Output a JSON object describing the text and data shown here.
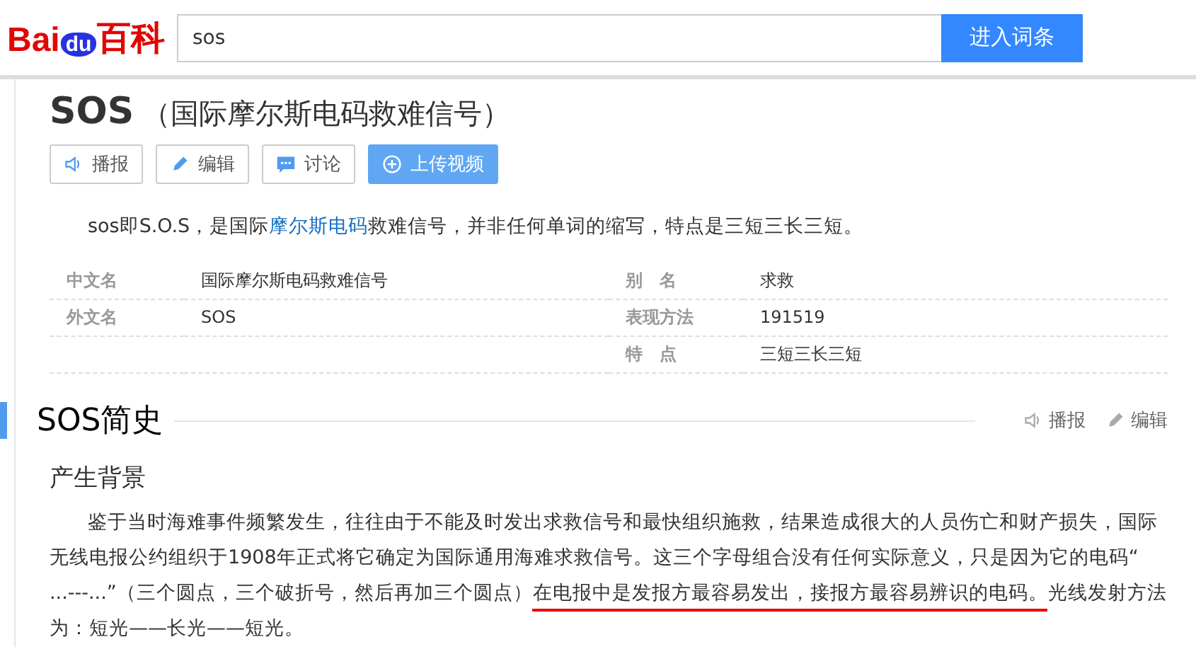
{
  "header": {
    "logo_latin": "Bai",
    "logo_paw": "du",
    "logo_cn": "百科",
    "search": {
      "value": "sos"
    },
    "search_button": "进入词条"
  },
  "entry": {
    "title": "SOS",
    "subtitle": "（国际摩尔斯电码救难信号）",
    "actions": [
      {
        "label": "播报",
        "kind": "speaker",
        "primary": false
      },
      {
        "label": "编辑",
        "kind": "pencil",
        "primary": false
      },
      {
        "label": "讨论",
        "kind": "chat",
        "primary": false
      },
      {
        "label": "上传视频",
        "kind": "plus",
        "primary": true
      }
    ],
    "summary": [
      {
        "text": "sos即S.O.S，是国际",
        "kind": "plain"
      },
      {
        "text": "摩尔斯电码",
        "kind": "link"
      },
      {
        "text": "救难信号，并非任何单词的缩写，特点是三短三长三短。",
        "kind": "plain"
      }
    ],
    "basic_info": [
      {
        "name": "中文名",
        "value": "国际摩尔斯电码救难信号",
        "name_2": "别　名",
        "value_2": "求救"
      },
      {
        "name": "外文名",
        "value": "SOS",
        "name_2": "表现方法",
        "value_2": "191519"
      },
      {
        "name_2": "特　点",
        "value_2": "三短三长三短"
      }
    ]
  },
  "section": {
    "title": "SOS简史",
    "actions": [
      {
        "label": "播报",
        "kind": "speaker"
      },
      {
        "label": "编辑",
        "kind": "pencil"
      }
    ],
    "subheading": "产生背景",
    "paragraph": [
      {
        "text": "鉴于当时海难事件频繁发生，往往由于不能及时发出求救信号和最快组织施救，结果造成很大的人员伤亡和财产损失，国际无线电报公约组织于1908年正式将它确定为国际通用海难求救信号。这三个字母组合没有任何实际意义，只是因为它的电码“ ...---...”（三个圆点，三个破折号，然后再加三个圆点）",
        "underlined": false
      },
      {
        "text": "在电报中是发报方最容易发出，接报方最容易辨识的电码。",
        "underlined": true
      },
      {
        "text": "光线发射方法为：短光——长光——短光。",
        "underlined": false
      }
    ]
  }
}
